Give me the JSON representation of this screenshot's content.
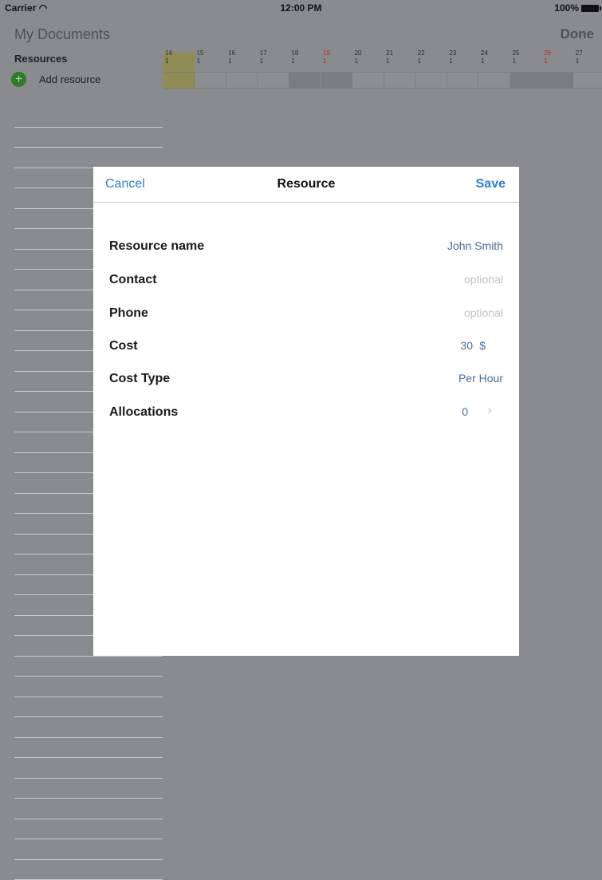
{
  "status_bar": {
    "carrier": "Carrier",
    "time": "12:00 PM",
    "battery": "100%"
  },
  "nav": {
    "title": "My Documents",
    "done_label": "Done"
  },
  "resources": {
    "header": "Resources",
    "add_label": "Add resource",
    "add_icon": "plus-circle-icon"
  },
  "timeline": {
    "days": [
      {
        "day": "14",
        "week": "1",
        "today": true,
        "weekend": false
      },
      {
        "day": "15",
        "week": "1",
        "today": false,
        "weekend": false
      },
      {
        "day": "16",
        "week": "1",
        "today": false,
        "weekend": false
      },
      {
        "day": "17",
        "week": "1",
        "today": false,
        "weekend": false
      },
      {
        "day": "18",
        "week": "1",
        "today": false,
        "weekend": true
      },
      {
        "day": "19",
        "week": "1",
        "today": false,
        "weekend": true,
        "red": true
      },
      {
        "day": "20",
        "week": "1",
        "today": false,
        "weekend": false
      },
      {
        "day": "21",
        "week": "1",
        "today": false,
        "weekend": false
      },
      {
        "day": "22",
        "week": "1",
        "today": false,
        "weekend": false
      },
      {
        "day": "23",
        "week": "1",
        "today": false,
        "weekend": false
      },
      {
        "day": "24",
        "week": "1",
        "today": false,
        "weekend": false
      },
      {
        "day": "25",
        "week": "1",
        "today": false,
        "weekend": true
      },
      {
        "day": "26",
        "week": "1",
        "today": false,
        "weekend": true,
        "red": true
      },
      {
        "day": "27",
        "week": "1",
        "today": false,
        "weekend": false
      }
    ]
  },
  "modal": {
    "cancel_label": "Cancel",
    "title": "Resource",
    "save_label": "Save",
    "fields": {
      "resource_name": {
        "label": "Resource name",
        "value": "John Smith"
      },
      "contact": {
        "label": "Contact",
        "placeholder": "optional"
      },
      "phone": {
        "label": "Phone",
        "placeholder": "optional"
      },
      "cost": {
        "label": "Cost",
        "value": "30",
        "unit": "$"
      },
      "cost_type": {
        "label": "Cost Type",
        "value": "Per Hour"
      },
      "allocations": {
        "label": "Allocations",
        "value": "0",
        "chevron_icon": "chevron-right-icon"
      }
    }
  }
}
